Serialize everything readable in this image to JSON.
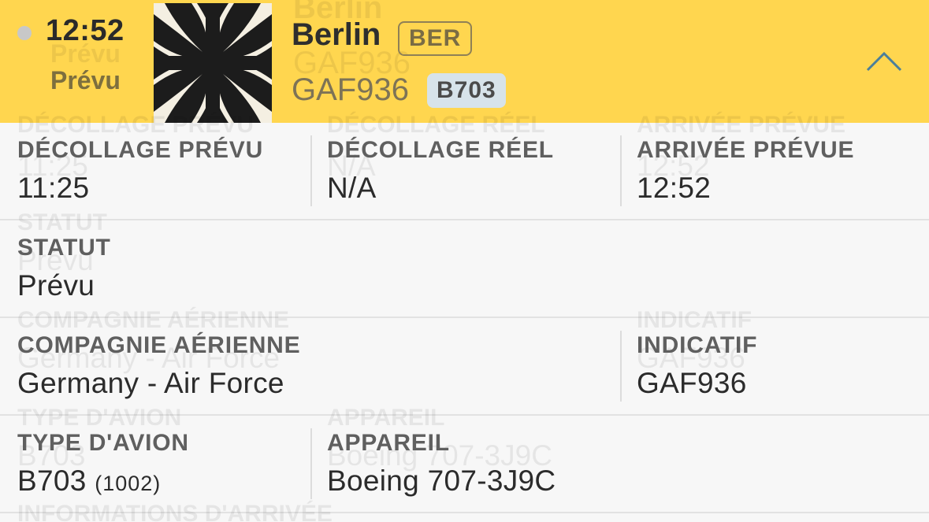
{
  "header": {
    "time": "12:52",
    "status": "Prévu",
    "logo_icon": "balkenkreuz-logo-icon",
    "destination": "Berlin",
    "destination_code": "BER",
    "flight_number": "GAF936",
    "aircraft_code": "B703",
    "collapse_icon": "chevron-up-icon",
    "colors": {
      "background": "#ffd64f",
      "aircraft_badge": "#d7e3ea"
    }
  },
  "details": {
    "scheduled_departure_label": "DÉCOLLAGE PRÉVU",
    "scheduled_departure": "11:25",
    "actual_departure_label": "DÉCOLLAGE RÉEL",
    "actual_departure": "N/A",
    "scheduled_arrival_label": "ARRIVÉE PRÉVUE",
    "scheduled_arrival": "12:52",
    "status_label": "STATUT",
    "status": "Prévu",
    "airline_label": "COMPAGNIE AÉRIENNE",
    "airline": "Germany - Air Force",
    "callsign_label": "INDICATIF",
    "callsign": "GAF936",
    "aircraft_type_label": "TYPE D'AVION",
    "aircraft_type": "B703",
    "aircraft_type_code": "(1002)",
    "aircraft_label": "APPAREIL",
    "aircraft": "Boeing 707-3J9C",
    "arrival_info_label": "INFORMATIONS D'ARRIVÉE"
  }
}
